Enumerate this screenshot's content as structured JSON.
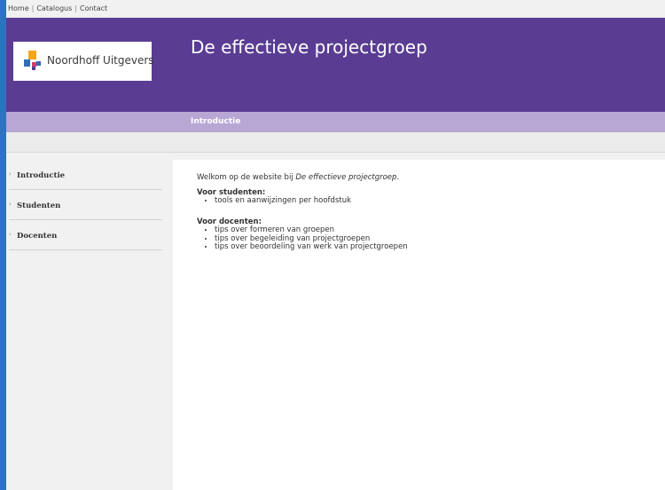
{
  "topnav": {
    "links": [
      "Home",
      "Catalogus",
      "Contact"
    ],
    "separator": "|"
  },
  "header": {
    "logo_text": "Noordhoff Uitgevers",
    "title": "De effectieve projectgroep",
    "subbar_label": "Introductie"
  },
  "sidebar": {
    "items": [
      {
        "label": "Introductie",
        "bullet": "›"
      },
      {
        "label": "Studenten",
        "bullet": "›"
      },
      {
        "label": "Docenten",
        "bullet": "›"
      }
    ]
  },
  "main": {
    "welcome_prefix": "Welkom op de website bij ",
    "welcome_emphasis": "De effectieve projectgroep",
    "welcome_suffix": ".",
    "students": {
      "heading": "Voor studenten",
      "colon": ":",
      "items": [
        "tools en aanwijzingen per hoofdstuk"
      ]
    },
    "teachers": {
      "heading": "Voor docenten",
      "colon": ":",
      "items": [
        "tips over formeren van groepen",
        "tips over begeleiding van projectgroepen",
        "tips over beoordeling van werk van projectgroepen"
      ]
    }
  },
  "colors": {
    "frame": "#2f73c0",
    "header_purple": "#5a3d93",
    "subbar_lilac": "#b8a7d4"
  }
}
